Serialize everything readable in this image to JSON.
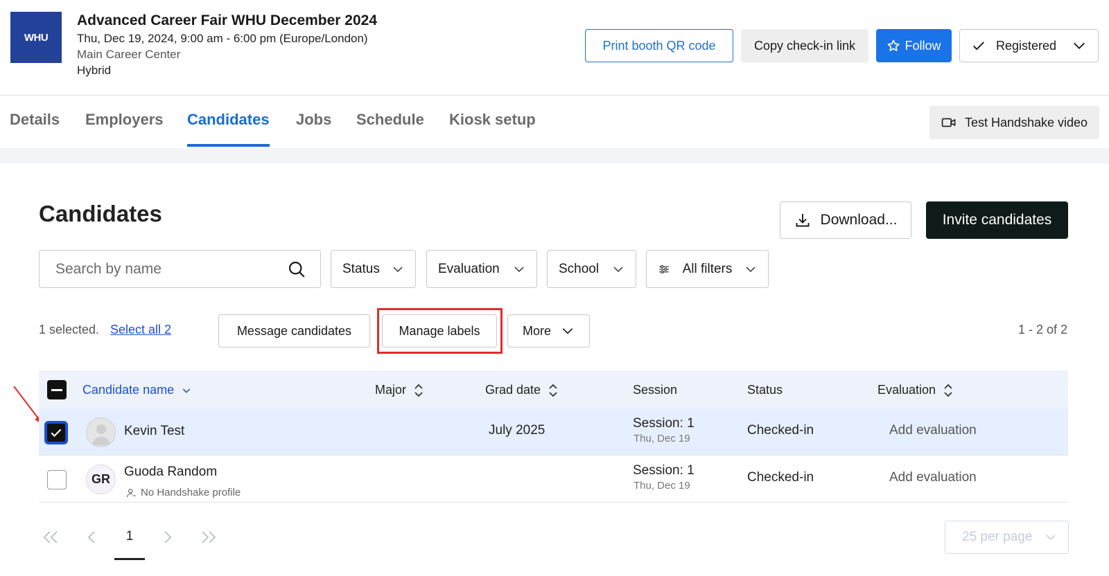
{
  "header": {
    "logo_text": "WHU",
    "title": "Advanced Career Fair WHU December 2024",
    "datetime": "Thu, Dec 19, 2024, 9:00 am - 6:00 pm (Europe/London)",
    "location": "Main Career Center",
    "format": "Hybrid",
    "print_label": "Print booth QR code",
    "copy_label": "Copy check-in link",
    "follow_label": "Follow",
    "registered_label": "Registered"
  },
  "tabs": [
    {
      "label": "Details"
    },
    {
      "label": "Employers"
    },
    {
      "label": "Candidates",
      "active": true
    },
    {
      "label": "Jobs"
    },
    {
      "label": "Schedule"
    },
    {
      "label": "Kiosk setup"
    }
  ],
  "video_button_label": "Test Handshake video",
  "main": {
    "title": "Candidates",
    "download_label": "Download...",
    "invite_label": "Invite candidates",
    "search_placeholder": "Search by name",
    "filters": [
      "Status",
      "Evaluation",
      "School",
      "All filters"
    ],
    "selection_text": "1 selected.",
    "select_all_label": "Select all 2",
    "message_label": "Message candidates",
    "manage_labels_label": "Manage labels",
    "more_label": "More",
    "range_text": "1 - 2 of 2"
  },
  "table": {
    "columns": [
      "Candidate name",
      "Major",
      "Grad date",
      "Session",
      "Status",
      "Evaluation"
    ],
    "rows": [
      {
        "name": "Kevin Test",
        "initials": "",
        "note": "",
        "major": "",
        "grad_date": "July 2025",
        "session": "Session: 1",
        "session_date": "Thu, Dec 19",
        "status": "Checked-in",
        "evaluation": "Add evaluation",
        "selected": true
      },
      {
        "name": "Guoda Random",
        "initials": "GR",
        "note": "No Handshake profile",
        "major": "",
        "grad_date": "",
        "session": "Session: 1",
        "session_date": "Thu, Dec 19",
        "status": "Checked-in",
        "evaluation": "Add evaluation",
        "selected": false
      }
    ]
  },
  "pagination": {
    "current_page": "1",
    "per_page_label": "25 per page"
  },
  "colors": {
    "accent_blue": "#1a73e8",
    "highlight_red": "#e32b2b",
    "invite_dark": "#0f1a1a"
  }
}
